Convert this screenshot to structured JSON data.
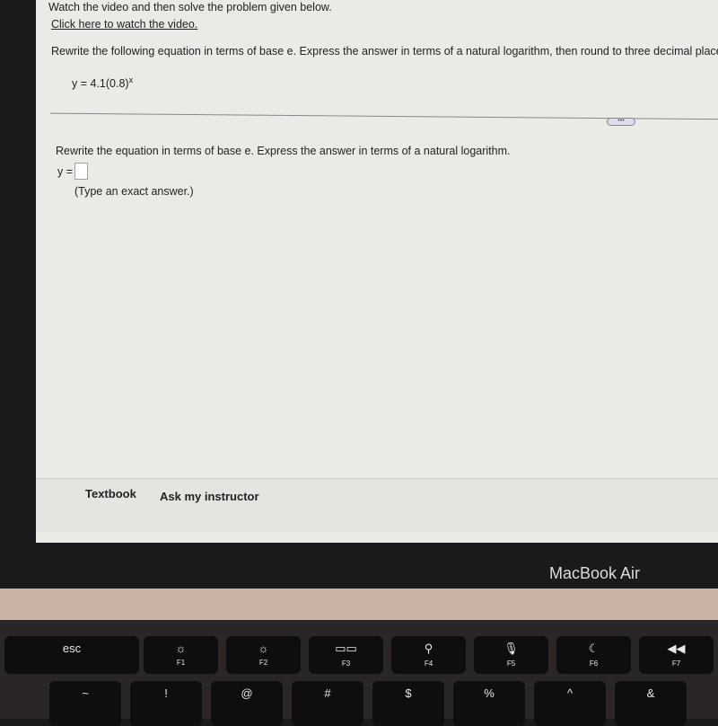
{
  "screen": {
    "top_text": "Watch the video and then solve the problem given below.",
    "video_link": "Click here to watch the video.",
    "question": "Rewrite the following equation in terms of base e. Express the answer in terms of a natural logarithm, then round to three decimal places.",
    "equation": {
      "base": "y = 4.1(0.8)",
      "exponent": "x"
    },
    "more_button": "•••",
    "sub_question": "Rewrite the equation in terms of base e. Express the answer in terms of a natural logarithm.",
    "answer_label": "y =",
    "answer_value": "",
    "hint": "(Type an exact answer.)",
    "bottom": {
      "textbook": "Textbook",
      "ask": "Ask my instructor"
    }
  },
  "laptop": {
    "label": "MacBook Air"
  },
  "keys": [
    {
      "g": "esc",
      "f": ""
    },
    {
      "g": "☼",
      "f": "F1"
    },
    {
      "g": "☼",
      "f": "F2"
    },
    {
      "g": "▭▭",
      "f": "F3"
    },
    {
      "g": "⚲",
      "f": "F4"
    },
    {
      "g": "🎙",
      "f": "F5"
    },
    {
      "g": "☾",
      "f": "F6"
    },
    {
      "g": "◀◀",
      "f": "F7"
    }
  ],
  "row2": [
    "~",
    "!",
    "@",
    "#",
    "$",
    "%",
    "^",
    "&"
  ]
}
